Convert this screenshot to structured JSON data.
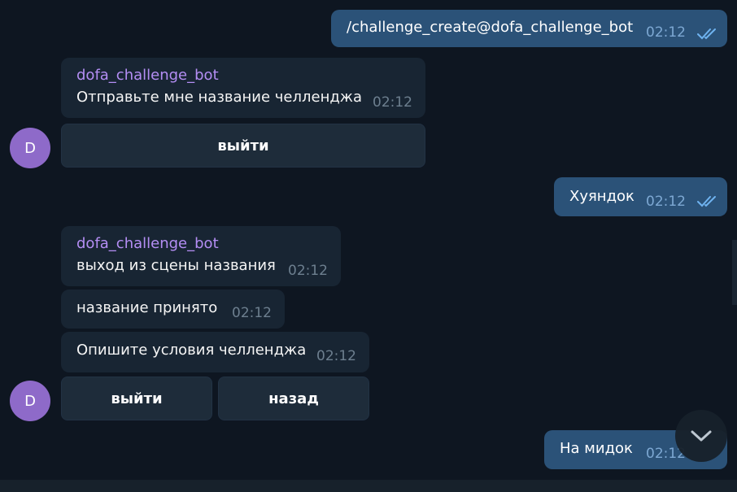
{
  "messages": {
    "m1": {
      "text": "/challenge_create@dofa_challenge_bot",
      "time": "02:12"
    },
    "m2": {
      "sender": "dofa_challenge_bot",
      "text": "Отправьте мне название челленджа",
      "time": "02:12"
    },
    "m3": {
      "text": "Хуяндок",
      "time": "02:12"
    },
    "m4": {
      "sender": "dofa_challenge_bot",
      "text": "выход из сцены названия",
      "time": "02:12"
    },
    "m5": {
      "text": "название принято",
      "time": "02:12"
    },
    "m6": {
      "text": "Опишите условия челленджа",
      "time": "02:12"
    },
    "m7": {
      "text": "На мидок",
      "time": "02:12"
    }
  },
  "keyboards": {
    "k1": {
      "exit_label": "выйти"
    },
    "k2": {
      "exit_label": "выйти",
      "back_label": "назад"
    }
  },
  "avatar": {
    "letter": "D",
    "color": "#8e6ac9"
  },
  "icons": {
    "read_ticks": "double-check-icon",
    "scroll_down": "chevron-down-icon"
  },
  "colors": {
    "background": "#0e1621",
    "outgoing_bubble": "#2b5278",
    "incoming_bubble": "#182533",
    "sender_name": "#b48ef4",
    "tick": "#6fb3f0"
  }
}
